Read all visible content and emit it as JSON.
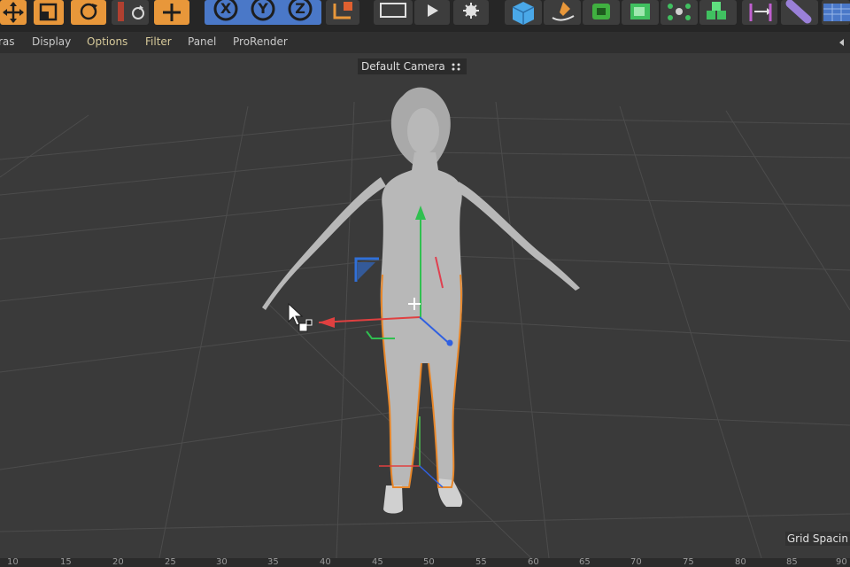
{
  "menubar": {
    "items": [
      {
        "label": "ras",
        "highlight": false
      },
      {
        "label": "Display",
        "highlight": false
      },
      {
        "label": "Options",
        "highlight": true
      },
      {
        "label": "Filter",
        "highlight": true
      },
      {
        "label": "Panel",
        "highlight": false
      },
      {
        "label": "ProRender",
        "highlight": false
      }
    ]
  },
  "toolbar": {
    "x_label": "X",
    "y_label": "Y",
    "z_label": "Z",
    "icons": [
      "move-icon",
      "scale-icon",
      "rotate-icon",
      "recent-tools-icon",
      "add-icon",
      "x-axis-icon",
      "y-axis-icon",
      "z-axis-icon",
      "coordinate-system-icon",
      "render-region-icon",
      "render-view-icon",
      "render-settings-icon",
      "cube-icon",
      "spline-pen-icon",
      "subdivision-icon",
      "generators-icon",
      "mograph-icon",
      "deformers-icon",
      "fields-icon",
      "camera-icon",
      "floor-icon"
    ]
  },
  "viewport": {
    "camera_label": "Default Camera",
    "grid_label": "Grid Spacin"
  },
  "ruler": {
    "ticks": [
      "10",
      "15",
      "20",
      "25",
      "30",
      "35",
      "40",
      "45",
      "50",
      "55",
      "60",
      "65",
      "70",
      "75",
      "80",
      "85",
      "90"
    ]
  },
  "colors": {
    "accent_orange": "#e8973a",
    "axis_blue": "#4a78c8",
    "selection_orange": "#e8872a",
    "axis_x": "#e04040",
    "axis_y": "#30c050",
    "axis_z": "#3060e0"
  }
}
